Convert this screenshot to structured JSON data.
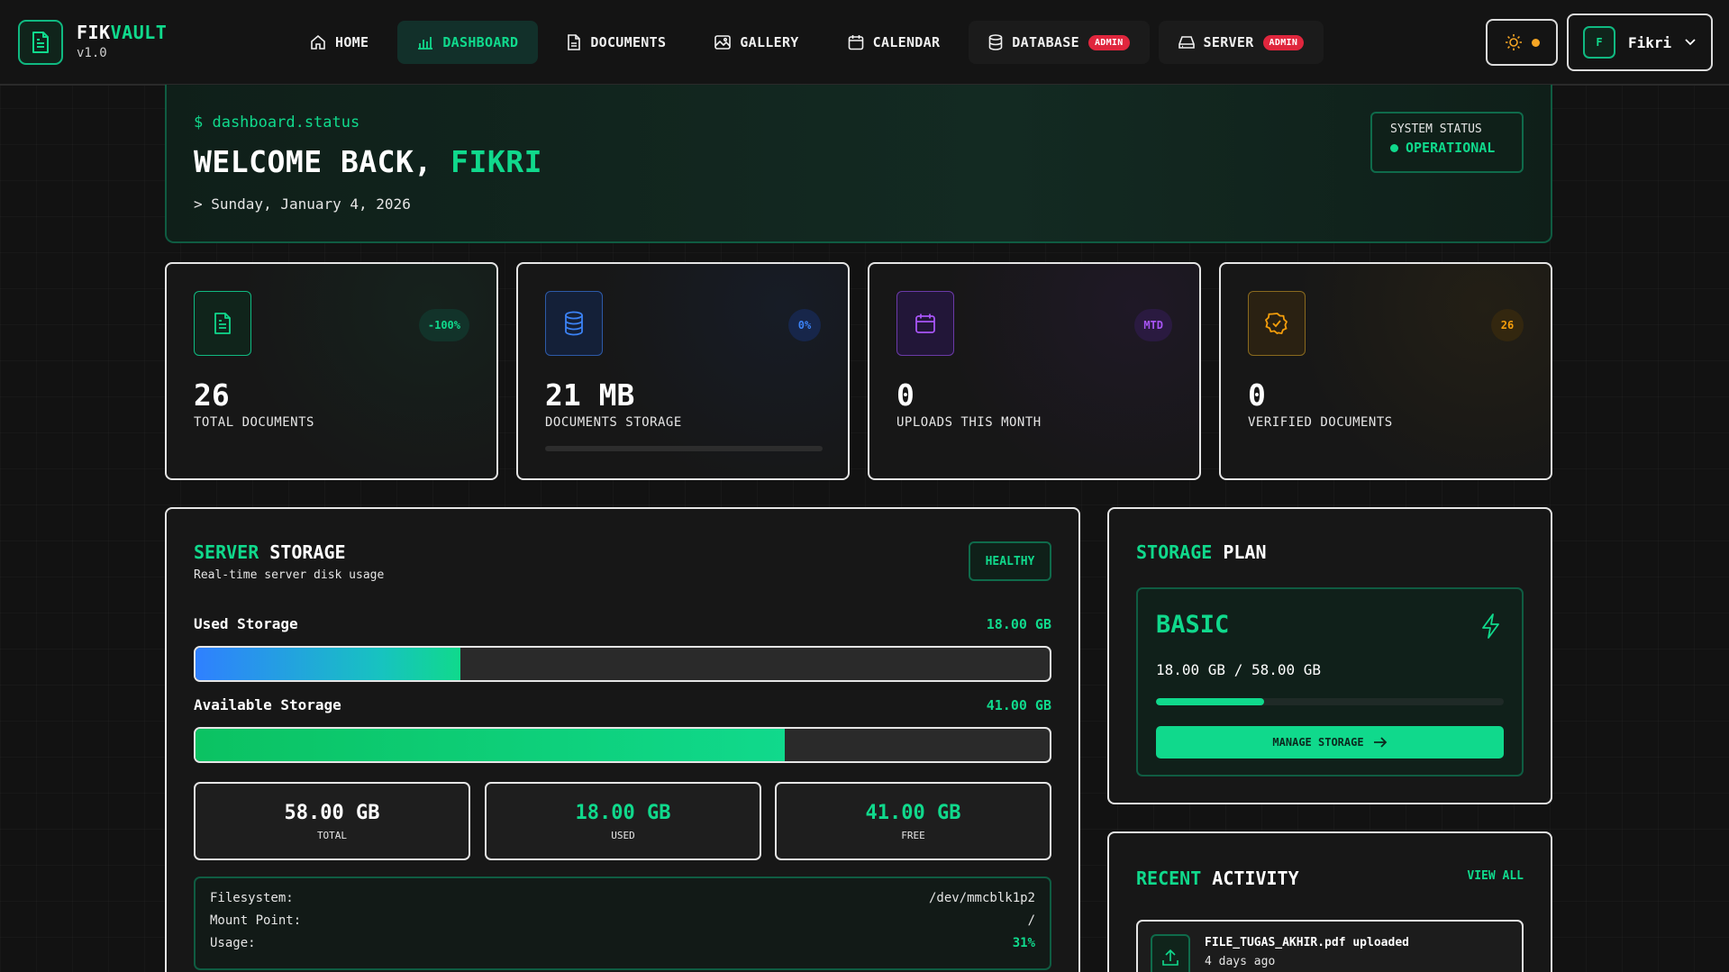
{
  "brand": {
    "name_a": "FIK",
    "name_b": "VAULT",
    "version": "v1.0"
  },
  "nav": {
    "home": "HOME",
    "dashboard": "DASHBOARD",
    "documents": "DOCUMENTS",
    "gallery": "GALLERY",
    "calendar": "CALENDAR",
    "database": "DATABASE",
    "server": "SERVER",
    "admin_badge": "ADMIN"
  },
  "user": {
    "initial": "F",
    "name": "Fikri"
  },
  "welcome": {
    "prompt": "$ dashboard.status",
    "title_prefix": "WELCOME BACK, ",
    "title_name": "FIKRI",
    "date": "> Sunday, January 4, 2026",
    "status_label": "SYSTEM STATUS",
    "status_value": "OPERATIONAL"
  },
  "stats": [
    {
      "value": "26",
      "label": "TOTAL DOCUMENTS",
      "badge": "-100%"
    },
    {
      "value": "21 MB",
      "label": "DOCUMENTS STORAGE",
      "badge": "0%"
    },
    {
      "value": "0",
      "label": "UPLOADS THIS MONTH",
      "badge": "MTD"
    },
    {
      "value": "0",
      "label": "VERIFIED DOCUMENTS",
      "badge": "26"
    }
  ],
  "server_storage": {
    "title_a": "SERVER",
    "title_b": " STORAGE",
    "subtitle": "Real-time server disk usage",
    "status": "HEALTHY",
    "used_label": "Used Storage",
    "used_value": "18.00 GB",
    "used_fraction": 0.31,
    "available_label": "Available Storage",
    "available_value": "41.00 GB",
    "available_fraction": 0.69,
    "total": "58.00 GB",
    "total_label": "TOTAL",
    "used": "18.00 GB",
    "used_short_label": "USED",
    "free": "41.00 GB",
    "free_label": "FREE",
    "filesystem_label": "Filesystem:",
    "filesystem": "/dev/mmcblk1p2",
    "mount_label": "Mount Point:",
    "mount": "/",
    "usage_label": "Usage:",
    "usage": "31%"
  },
  "storage_plan": {
    "title_a": "STORAGE",
    "title_b": " PLAN",
    "plan": "BASIC",
    "usage": "18.00 GB / 58.00 GB",
    "fraction": 0.31,
    "button": "MANAGE STORAGE"
  },
  "recent_activity": {
    "title_a": "RECENT",
    "title_b": " ACTIVITY",
    "view_all": "VIEW ALL",
    "items": [
      {
        "title": "FILE_TUGAS_AKHIR.pdf uploaded",
        "time": "4 days ago"
      }
    ]
  },
  "colors": {
    "accent": "#10d98c",
    "blue": "#3b82f6",
    "purple": "#a855f7",
    "amber": "#f59e0b",
    "admin": "#e0263d"
  }
}
